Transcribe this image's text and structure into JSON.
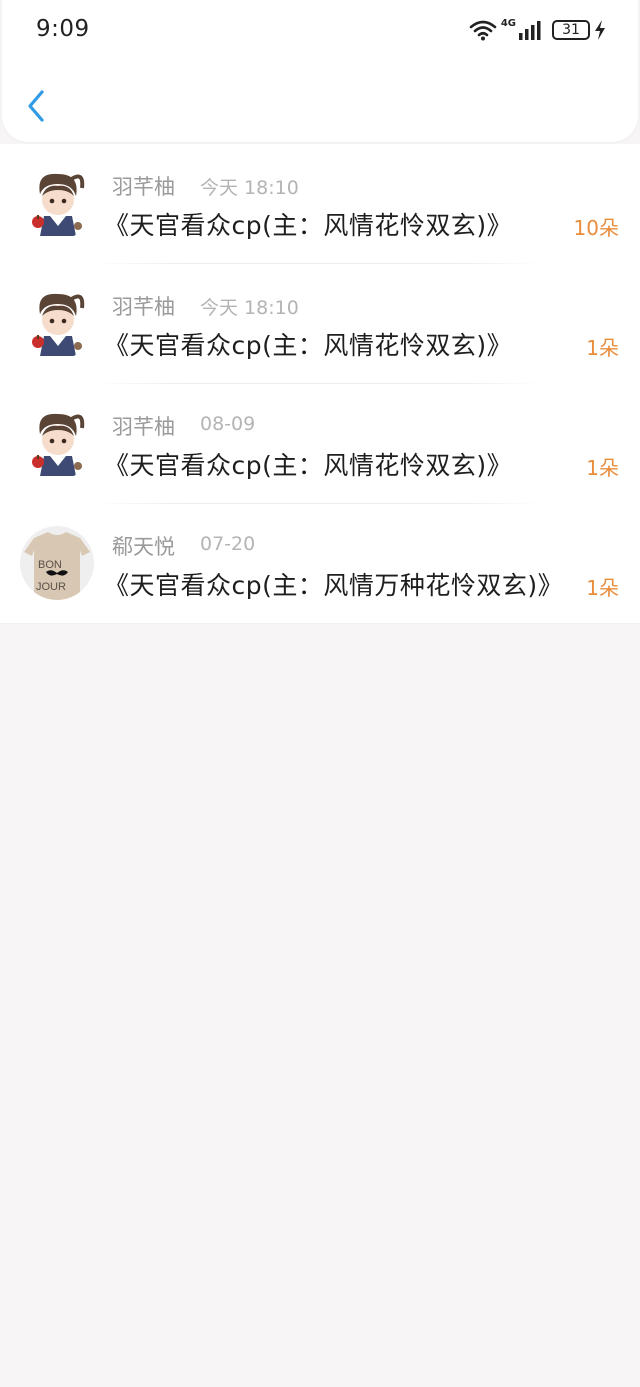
{
  "status_bar": {
    "time": "9:09",
    "network": "4G",
    "battery": "31"
  },
  "header": {
    "back_icon": "chevron-left-icon",
    "accent_color": "#2f9be6"
  },
  "items": [
    {
      "username": "羽芊柚",
      "time": "今天 18:10",
      "title": "《天官看众cp(主：风情花怜双玄)》",
      "count": "10朵",
      "avatar": "chibi-character-avatar"
    },
    {
      "username": "羽芊柚",
      "time": "今天 18:10",
      "title": "《天官看众cp(主：风情花怜双玄)》",
      "count": "1朵",
      "avatar": "chibi-character-avatar"
    },
    {
      "username": "羽芊柚",
      "time": "08-09",
      "title": "《天官看众cp(主：风情花怜双玄)》",
      "count": "1朵",
      "avatar": "chibi-character-avatar"
    },
    {
      "username": "郗天悦",
      "time": "07-20",
      "title": "《天官看众cp(主：风情万种花怜双玄)》",
      "count": "1朵",
      "avatar": "bonjour-tshirt-avatar",
      "avatar_text_1": "BON",
      "avatar_text_2": "JOUR"
    }
  ],
  "colors": {
    "count": "#e98c3c",
    "username": "#9a9a9a",
    "timestamp": "#b4b4b4",
    "title": "#1e1e1e",
    "background": "#f7f5f6"
  }
}
